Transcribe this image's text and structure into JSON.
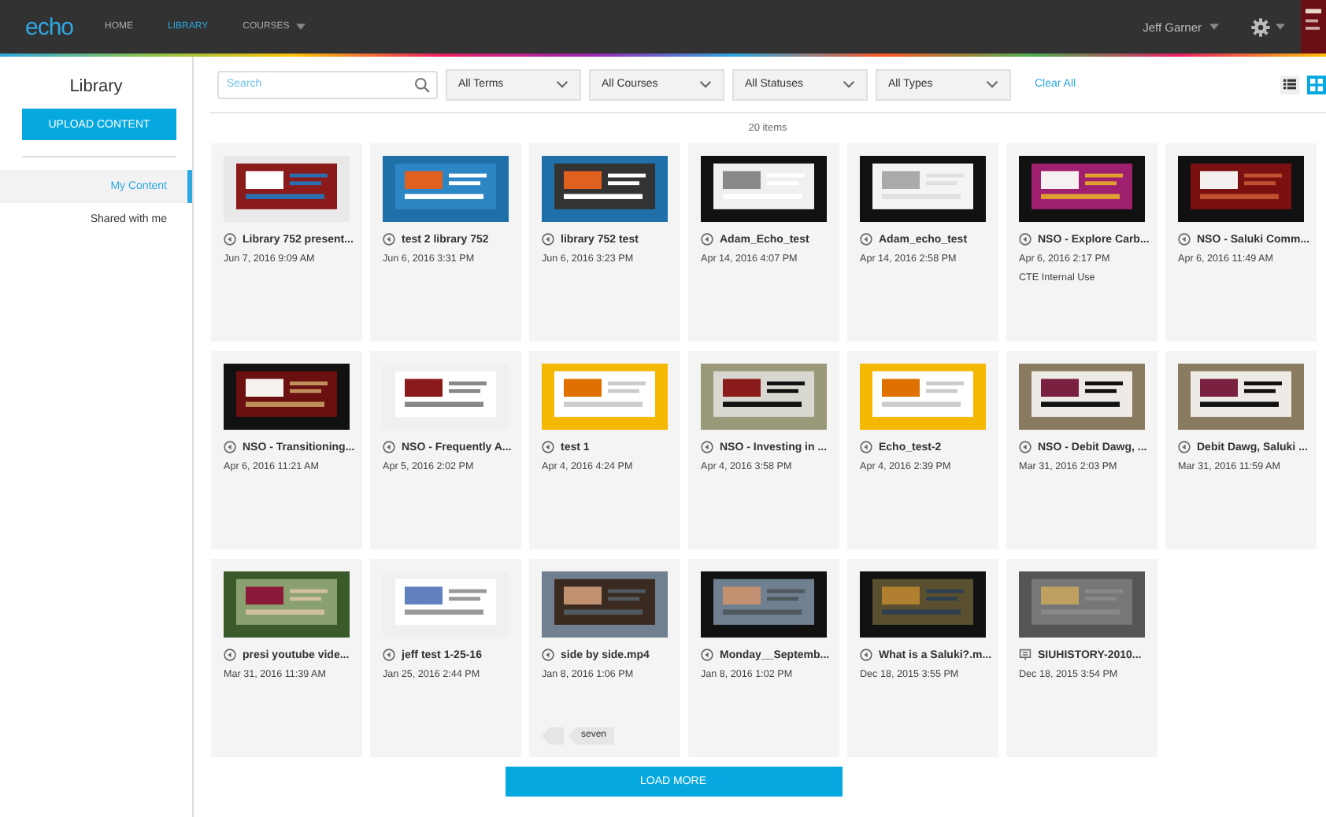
{
  "header": {
    "logo": "echo",
    "nav": [
      {
        "label": "HOME",
        "selected": false,
        "caret": false
      },
      {
        "label": "LIBRARY",
        "selected": true,
        "caret": false
      },
      {
        "label": "COURSES",
        "selected": false,
        "caret": true
      }
    ],
    "user": "Jeff Garner"
  },
  "sidebar": {
    "title": "Library",
    "upload_button": "UPLOAD CONTENT",
    "items": [
      {
        "label": "My Content",
        "selected": true
      },
      {
        "label": "Shared with me",
        "selected": false
      }
    ]
  },
  "filters": {
    "search": {
      "placeholder": "Search"
    },
    "dropdowns": [
      "All Terms",
      "All Courses",
      "All Statuses",
      "All Types"
    ],
    "clear": "Clear All",
    "view_modes": [
      {
        "kind": "list",
        "selected": false
      },
      {
        "kind": "grid",
        "selected": true
      }
    ]
  },
  "count": "20 items",
  "items": [
    {
      "kind": "video",
      "title": "Library 752 present...",
      "date": "Jun 7, 2016 9:09 AM"
    },
    {
      "kind": "video",
      "title": "test 2 library 752",
      "date": "Jun 6, 2016 3:31 PM"
    },
    {
      "kind": "video",
      "title": "library 752 test",
      "date": "Jun 6, 2016 3:23 PM"
    },
    {
      "kind": "video",
      "title": "Adam_Echo_test",
      "date": "Apr 14, 2016 4:07 PM"
    },
    {
      "kind": "video",
      "title": "Adam_echo_test",
      "date": "Apr 14, 2016 2:58 PM"
    },
    {
      "kind": "video",
      "title": "NSO - Explore Carb...",
      "date": "Apr 6, 2016 2:17 PM",
      "description": "CTE Internal Use"
    },
    {
      "kind": "video",
      "title": "NSO - Saluki Comm...",
      "date": "Apr 6, 2016 11:49 AM"
    },
    {
      "kind": "video",
      "title": "NSO - Transitioning...",
      "date": "Apr 6, 2016 11:21 AM"
    },
    {
      "kind": "video",
      "title": "NSO - Frequently A...",
      "date": "Apr 5, 2016 2:02 PM"
    },
    {
      "kind": "video",
      "title": "test 1",
      "date": "Apr 4, 2016 4:24 PM"
    },
    {
      "kind": "video",
      "title": "NSO - Investing in ...",
      "date": "Apr 4, 2016 3:58 PM"
    },
    {
      "kind": "video",
      "title": "Echo_test-2",
      "date": "Apr 4, 2016 2:39 PM"
    },
    {
      "kind": "video",
      "title": "NSO - Debit Dawg, ...",
      "date": "Mar 31, 2016 2:03 PM"
    },
    {
      "kind": "video",
      "title": "Debit Dawg, Saluki ...",
      "date": "Mar 31, 2016 11:59 AM"
    },
    {
      "kind": "video",
      "title": "presi youtube vide...",
      "date": "Mar 31, 2016 11:39 AM"
    },
    {
      "kind": "video",
      "title": "jeff test 1-25-16",
      "date": "Jan 25, 2016 2:44 PM"
    },
    {
      "kind": "video",
      "title": "side by side.mp4",
      "date": "Jan 8, 2016 1:06 PM",
      "tags": [
        "seven"
      ]
    },
    {
      "kind": "video",
      "title": "Monday__Septemb...",
      "date": "Jan 8, 2016 1:02 PM"
    },
    {
      "kind": "video",
      "title": "What is a Saluki?.m...",
      "date": "Dec 18, 2015 3:55 PM"
    },
    {
      "kind": "presentation",
      "title": "SIUHISTORY-2010...",
      "date": "Dec 18, 2015 3:54 PM"
    }
  ],
  "load_more": "LOAD MORE"
}
